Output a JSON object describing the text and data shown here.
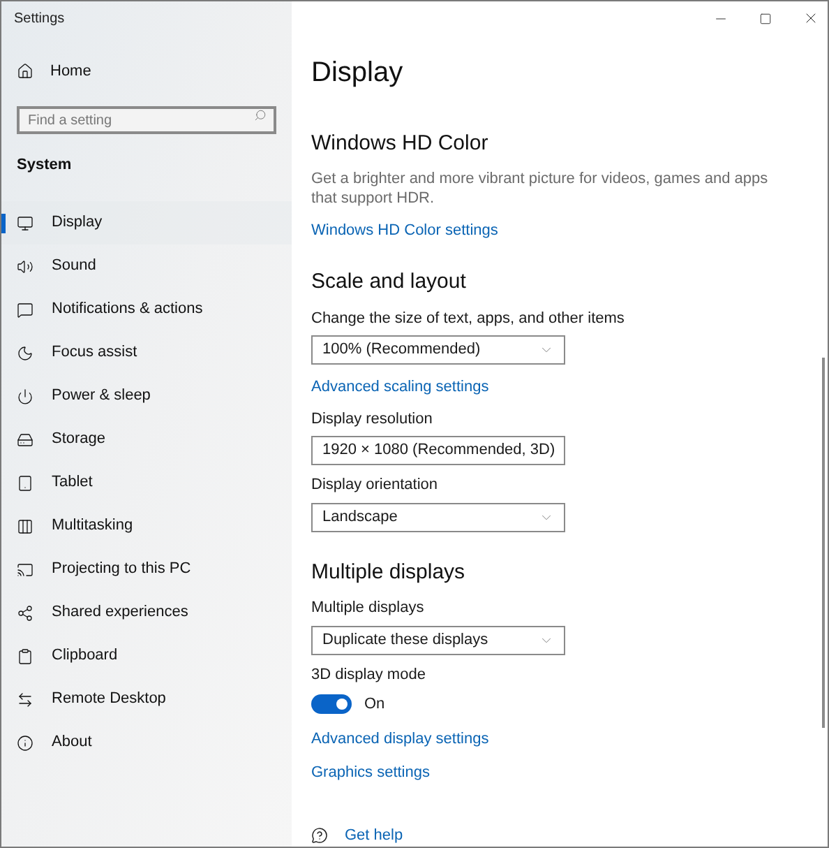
{
  "window": {
    "title": "Settings"
  },
  "sidebar": {
    "home": "Home",
    "search": {
      "placeholder": "Find a setting"
    },
    "section": "System",
    "items": [
      {
        "label": "Display",
        "selected": true
      },
      {
        "label": "Sound",
        "selected": false
      },
      {
        "label": "Notifications & actions",
        "selected": false
      },
      {
        "label": "Focus assist",
        "selected": false
      },
      {
        "label": "Power & sleep",
        "selected": false
      },
      {
        "label": "Storage",
        "selected": false
      },
      {
        "label": "Tablet",
        "selected": false
      },
      {
        "label": "Multitasking",
        "selected": false
      },
      {
        "label": "Projecting to this PC",
        "selected": false
      },
      {
        "label": "Shared experiences",
        "selected": false
      },
      {
        "label": "Clipboard",
        "selected": false
      },
      {
        "label": "Remote Desktop",
        "selected": false
      },
      {
        "label": "About",
        "selected": false
      }
    ]
  },
  "content": {
    "title": "Display",
    "sections": [
      {
        "heading": "Windows HD Color",
        "items": [
          {
            "kind": "text",
            "text": "Get a brighter and more vibrant picture for videos, games and apps that support HDR."
          },
          {
            "kind": "link",
            "text": "Windows HD Color settings"
          }
        ]
      },
      {
        "heading": "Scale and layout",
        "items": [
          {
            "kind": "dropdown",
            "label": "Change the size of text, apps, and other items",
            "value": "100% (Recommended)"
          },
          {
            "kind": "link",
            "text": "Advanced scaling settings"
          },
          {
            "kind": "dropdown",
            "label": "Display resolution",
            "value": "1920 × 1080 (Recommended, 3D)"
          },
          {
            "kind": "dropdown",
            "label": "Display orientation",
            "value": "Landscape"
          }
        ]
      },
      {
        "heading": "Multiple displays",
        "items": [
          {
            "kind": "dropdown",
            "label": "Multiple displays",
            "value": "Duplicate these displays"
          },
          {
            "kind": "toggle",
            "label": "3D display mode",
            "on": true,
            "state_text": "On"
          },
          {
            "kind": "link",
            "text": "Advanced display settings"
          },
          {
            "kind": "link",
            "text": "Graphics settings"
          }
        ]
      }
    ],
    "help": "Get help"
  }
}
